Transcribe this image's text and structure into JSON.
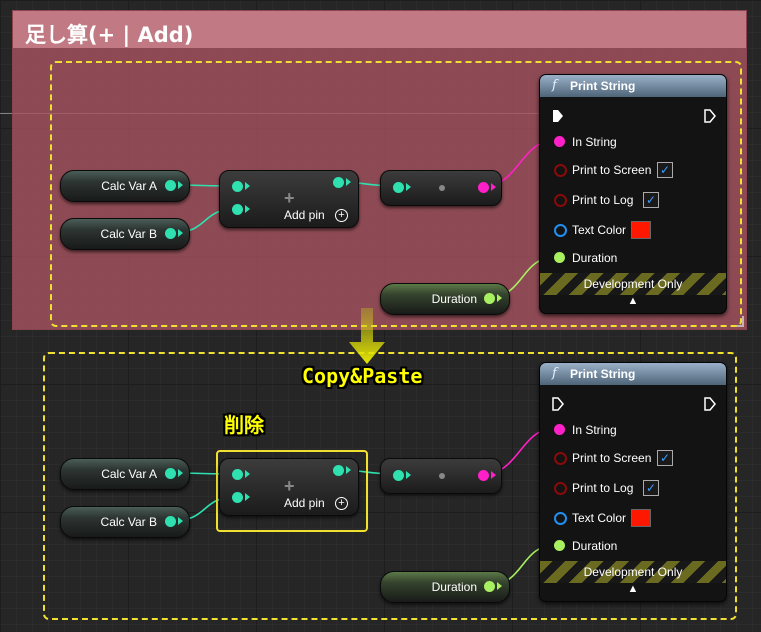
{
  "comment": {
    "title": "足し算(+ | Add)",
    "color": "#c17a83"
  },
  "annotations": {
    "copy_paste": "Copy&Paste",
    "delete": "削除"
  },
  "nodes": {
    "var_a": "Calc Var A",
    "var_b": "Calc Var B",
    "add_pin": "Add pin",
    "duration_var": "Duration"
  },
  "print_string": {
    "title": "Print String",
    "in_string": "In String",
    "print_to_screen": "Print to Screen",
    "print_to_log": "Print to Log",
    "text_color": "Text Color",
    "duration": "Duration",
    "development_only": "Development Only",
    "text_color_value": "#ff1800",
    "print_to_screen_checked": true,
    "print_to_log_checked": true
  },
  "colors": {
    "float_pin": "#2fe0b0",
    "string_pin": "#ff20c8",
    "duration_pin": "#a8f060",
    "selection": "#f0e030",
    "annotation_text": "#ffff00"
  }
}
